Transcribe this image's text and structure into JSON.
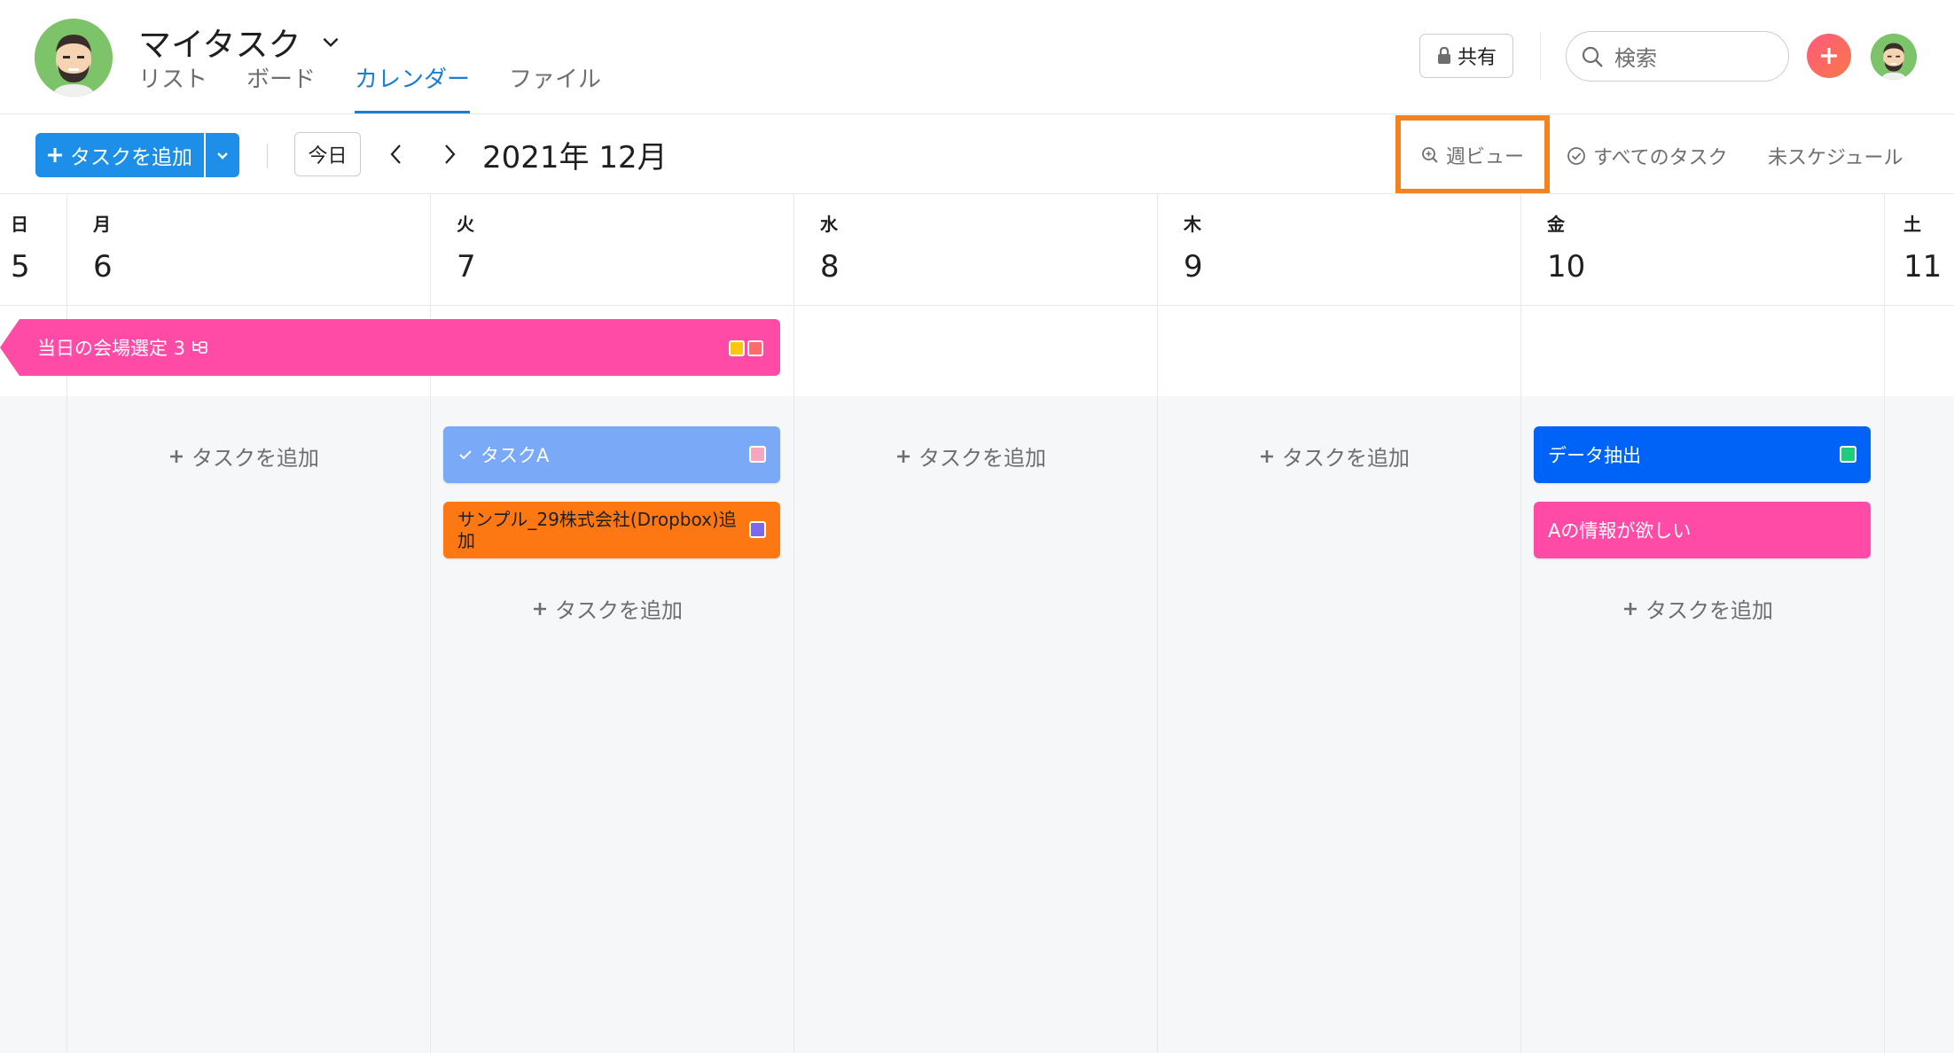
{
  "header": {
    "title": "マイタスク",
    "tabs": [
      {
        "label": "リスト",
        "active": false
      },
      {
        "label": "ボード",
        "active": false
      },
      {
        "label": "カレンダー",
        "active": true
      },
      {
        "label": "ファイル",
        "active": false
      }
    ],
    "share_label": "共有",
    "search_placeholder": "検索"
  },
  "toolbar": {
    "add_task_label": "タスクを追加",
    "today_label": "今日",
    "month_label": "2021年 12月",
    "week_view_label": "週ビュー",
    "all_tasks_label": "すべてのタスク",
    "unscheduled_label": "未スケジュール"
  },
  "calendar": {
    "days": [
      {
        "name": "日",
        "num": "5"
      },
      {
        "name": "月",
        "num": "6"
      },
      {
        "name": "火",
        "num": "7"
      },
      {
        "name": "水",
        "num": "8"
      },
      {
        "name": "木",
        "num": "9"
      },
      {
        "name": "金",
        "num": "10"
      },
      {
        "name": "土",
        "num": "11"
      }
    ],
    "multi_day_task": {
      "label": "当日の会場選定 3",
      "colors": [
        "#f9c80e",
        "#ff6b6b"
      ]
    },
    "add_task_label": "タスクを追加",
    "tasks": {
      "task_a": {
        "label": "タスクA",
        "color": "#7aa9f7",
        "tag_color": "#f7a6c0"
      },
      "sample": {
        "label": "サンプル_29株式会社(Dropbox)追加",
        "label_line1": "サンプル_29株式会社(Dropbox)追",
        "label_line2": "加",
        "color": "#fd7712",
        "tag_color": "#7b68ee"
      },
      "data_extract": {
        "label": "データ抽出",
        "color": "#0063f7",
        "tag_color": "#1ecc7c"
      },
      "info_wanted": {
        "label": "Aの情報が欲しい",
        "color": "#ff4ba5"
      }
    }
  },
  "colors": {
    "accent": "#1d8fe8",
    "highlight": "#f4821f"
  }
}
